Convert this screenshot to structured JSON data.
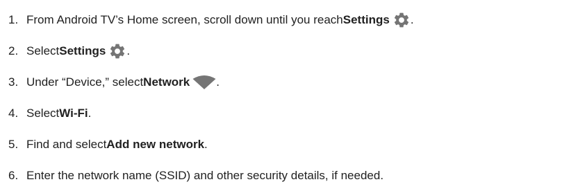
{
  "steps": [
    {
      "number": "1.",
      "pre": "From Android TV’s Home screen, scroll down until you reach ",
      "bold": "Settings",
      "icon": "gear-icon",
      "post": "."
    },
    {
      "number": "2.",
      "pre": "Select ",
      "bold": "Settings",
      "icon": "gear-icon",
      "post": "."
    },
    {
      "number": "3.",
      "pre": "Under “Device,” select ",
      "bold": "Network",
      "icon": "wifi-icon",
      "post": "."
    },
    {
      "number": "4.",
      "pre": "Select ",
      "bold": "Wi-Fi",
      "post": "."
    },
    {
      "number": "5.",
      "pre": "Find and select ",
      "bold": "Add new network",
      "post": "."
    },
    {
      "number": "6.",
      "pre": "Enter the network name (SSID) and other security details, if needed.",
      "bold": "",
      "post": ""
    }
  ],
  "colors": {
    "text": "#212121",
    "icon": "#757575"
  }
}
